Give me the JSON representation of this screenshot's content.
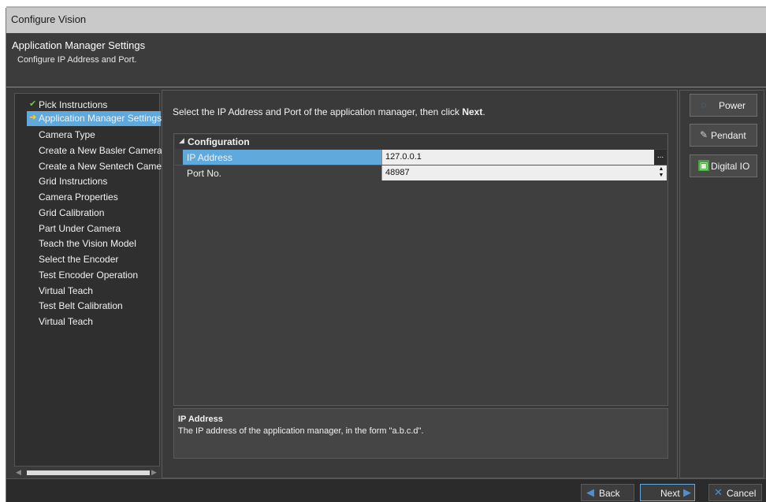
{
  "window": {
    "title": "Configure Vision"
  },
  "header": {
    "title": "Application Manager Settings",
    "subtitle": "Configure IP Address and Port."
  },
  "nav": {
    "items": [
      {
        "label": "Pick Instructions",
        "state": "done",
        "icon": "checkmark-icon"
      },
      {
        "label": "Application Manager Settings",
        "state": "active",
        "icon": "arrow-right-icon"
      },
      {
        "label": "Camera Type",
        "state": "pending"
      },
      {
        "label": "Create a New Basler Camera",
        "state": "pending"
      },
      {
        "label": "Create a New Sentech Camera",
        "state": "pending"
      },
      {
        "label": "Grid Instructions",
        "state": "pending"
      },
      {
        "label": "Camera Properties",
        "state": "pending"
      },
      {
        "label": "Grid Calibration",
        "state": "pending"
      },
      {
        "label": "Part Under Camera",
        "state": "pending"
      },
      {
        "label": "Teach the Vision Model",
        "state": "pending"
      },
      {
        "label": "Select the Encoder",
        "state": "pending"
      },
      {
        "label": "Test Encoder Operation",
        "state": "pending"
      },
      {
        "label": "Virtual Teach",
        "state": "pending"
      },
      {
        "label": "Test Belt Calibration",
        "state": "pending"
      },
      {
        "label": "Virtual Teach",
        "state": "pending"
      }
    ]
  },
  "main": {
    "instruction_pre": "Select the IP Address and Port of the application manager, then click ",
    "instruction_bold": "Next",
    "instruction_post": ".",
    "property_grid": {
      "category": "Configuration",
      "rows": [
        {
          "name": "IP Address",
          "value": "127.0.0.1",
          "editor": "ellipsis-button"
        },
        {
          "name": "Port No.",
          "value": "48987",
          "editor": "spinner"
        }
      ],
      "ellipsis_label": "..."
    },
    "description": {
      "title": "IP Address",
      "text": "The IP address of the application manager, in the form \"a.b.c.d\"."
    }
  },
  "side_buttons": [
    {
      "label": "Power",
      "icon": "power-icon"
    },
    {
      "label": "Pendant",
      "icon": "pendant-icon"
    },
    {
      "label": "Digital IO",
      "icon": "digital-io-icon"
    }
  ],
  "footer": {
    "back_label": "Back",
    "next_label": "Next",
    "cancel_label": "Cancel"
  },
  "colors": {
    "selection": "#5fa9dd",
    "panel": "#3a3a3a",
    "done_check": "#6ccf3a",
    "active_arrow": "#f5d23a",
    "accent_icon": "#4d8fd1"
  }
}
